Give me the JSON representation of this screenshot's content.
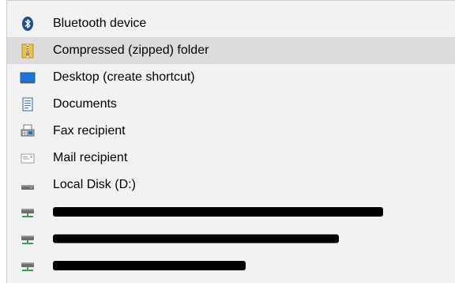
{
  "menu": {
    "items": [
      {
        "label": "Bluetooth device",
        "icon": "bluetooth-icon"
      },
      {
        "label": "Compressed (zipped) folder",
        "icon": "zip-folder-icon",
        "highlighted": true
      },
      {
        "label": "Desktop (create shortcut)",
        "icon": "desktop-icon"
      },
      {
        "label": "Documents",
        "icon": "documents-icon"
      },
      {
        "label": "Fax recipient",
        "icon": "fax-icon"
      },
      {
        "label": "Mail recipient",
        "icon": "mail-icon"
      },
      {
        "label": "Local Disk (D:)",
        "icon": "drive-icon"
      },
      {
        "label": "",
        "icon": "network-drive-icon",
        "redacted": true
      },
      {
        "label": "",
        "icon": "network-drive-icon",
        "redacted": true
      },
      {
        "label": "",
        "icon": "network-drive-icon",
        "redacted": true
      }
    ]
  },
  "colors": {
    "menu_background": "#f2f2f2",
    "highlight_background": "#dcdcdc",
    "bluetooth_blue": "#1f4e8c",
    "desktop_blue": "#1e73d8",
    "zip_yellow": "#e8c24a",
    "network_green": "#3aa04a"
  }
}
